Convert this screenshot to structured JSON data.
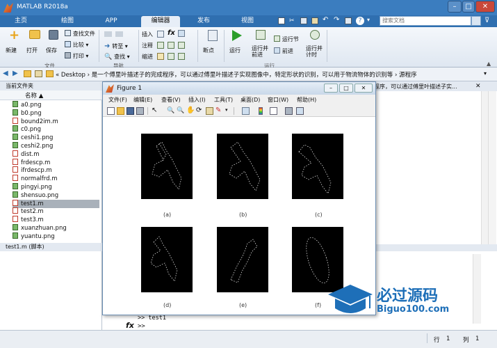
{
  "app": {
    "title": "MATLAB R2018a"
  },
  "tabs": [
    "主页",
    "绘图",
    "APP",
    "编辑器",
    "发布",
    "视图"
  ],
  "search": {
    "placeholder": "搜索文档"
  },
  "ribbon": {
    "file": {
      "new": "新建",
      "open": "打开",
      "save": "保存",
      "find_files": "查找文件",
      "compare": "比较",
      "print": "打印",
      "section": "文件"
    },
    "nav": {
      "goto": "转至",
      "find": "查找",
      "section": "导航"
    },
    "edit": {
      "insert": "插入",
      "comment": "注释",
      "indent": "缩进",
      "fx": "fx"
    },
    "breakpoints": {
      "label": "断点"
    },
    "run": {
      "run": "运行",
      "run_advance": "运行并\n前进",
      "run_section": "运行节",
      "advance": "前进",
      "run_time": "运行并\n计时",
      "section": "运行"
    }
  },
  "address": {
    "path": "« Desktop › 是一个傅里叶描述子的完成程序，可以通过傅里叶描述子实现图像中，特定形状的识别，可以用于物流物体的识别等 › 源程序"
  },
  "left_panel": {
    "title": "当前文件夹",
    "col_name": "名称 ▲",
    "files": [
      "a0.png",
      "b0.png",
      "bound2im.m",
      "c0.png",
      "ceshi1.png",
      "ceshi2.png",
      "dist.m",
      "frdescp.m",
      "ifrdescp.m",
      "normalfrd.m",
      "pingyi.png",
      "shensuo.png",
      "test1.m",
      "test2.m",
      "test3.m",
      "xuanzhuan.png",
      "yuantu.png"
    ],
    "selected": "test1.m",
    "detail": "test1.m  (脚本)"
  },
  "right": {
    "cmd_snippet": "程序，可以通过傅里叶描述子实..."
  },
  "figure": {
    "title": "Figure 1",
    "menu": [
      "文件(F)",
      "编辑(E)",
      "查看(V)",
      "插入(I)",
      "工具(T)",
      "桌面(D)",
      "窗口(W)",
      "帮助(H)"
    ],
    "panels": [
      "(a)",
      "(b)",
      "(c)",
      "(d)",
      "(e)",
      "(f)"
    ]
  },
  "command": {
    "history_line": ">> test1",
    "prompt": ">>",
    "fx": "fx"
  },
  "status": {
    "row_label": "行",
    "row": "1",
    "col_label": "列",
    "col": "1"
  },
  "watermark": {
    "title": "必过源码",
    "url": "Biguo100.com"
  },
  "colors": {
    "titlebar": "#3b7dbf",
    "tabstrip": "#2f6fb0",
    "selected_file": "#a9b1ba"
  }
}
